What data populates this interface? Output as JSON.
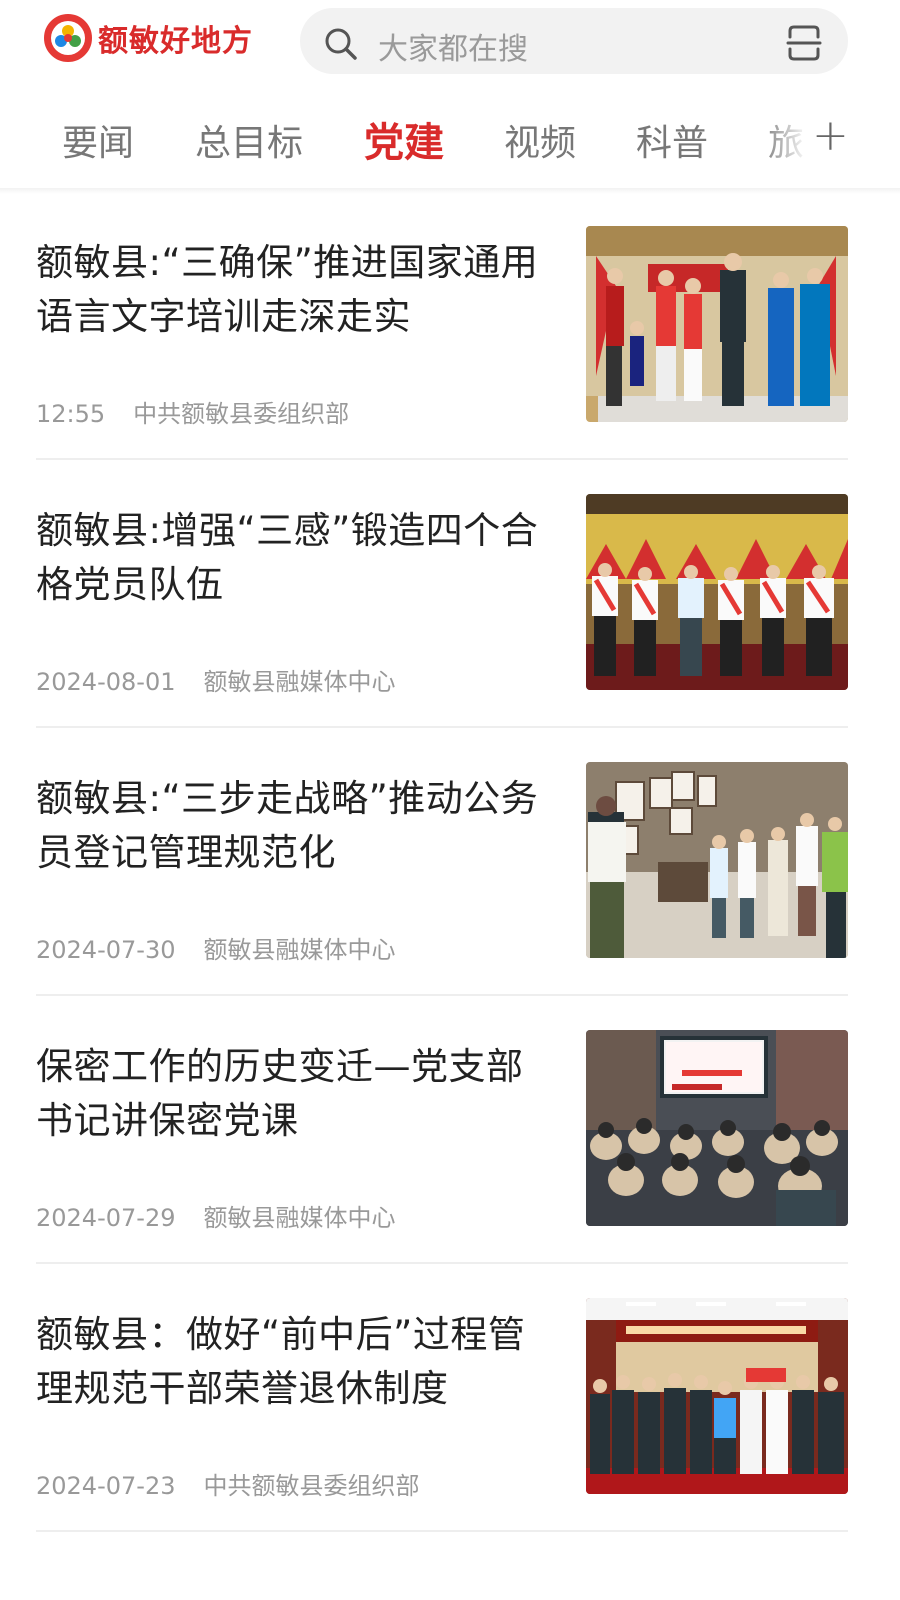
{
  "app": {
    "name": "额敏好地方",
    "brand_color": "#d92b2b"
  },
  "search": {
    "placeholder": "大家都在搜",
    "icon": "search-icon",
    "right_icon": "scan-icon"
  },
  "tabs": {
    "items": [
      {
        "label": "要闻"
      },
      {
        "label": "总目标"
      },
      {
        "label": "党建",
        "active": true
      },
      {
        "label": "视频"
      },
      {
        "label": "科普"
      },
      {
        "label": "旅"
      }
    ],
    "add_label": "+"
  },
  "news": [
    {
      "title": "额敏县:“三确保”推进国家通用语言文字培训走深走实",
      "time": "12:55",
      "source": "中共额敏县委组织部"
    },
    {
      "title": "额敏县:增强“三感”锻造四个合格党员队伍",
      "time": "2024-08-01",
      "source": "额敏县融媒体中心"
    },
    {
      "title": "额敏县:“三步走战略”推动公务员登记管理规范化",
      "time": "2024-07-30",
      "source": "额敏县融媒体中心"
    },
    {
      "title": "保密工作的历史变迁—党支部书记讲保密党课",
      "time": "2024-07-29",
      "source": "额敏县融媒体中心"
    },
    {
      "title": "额敏县：做好“前中后”过程管理规范干部荣誉退休制度",
      "time": "2024-07-23",
      "source": "中共额敏县委组织部"
    }
  ]
}
